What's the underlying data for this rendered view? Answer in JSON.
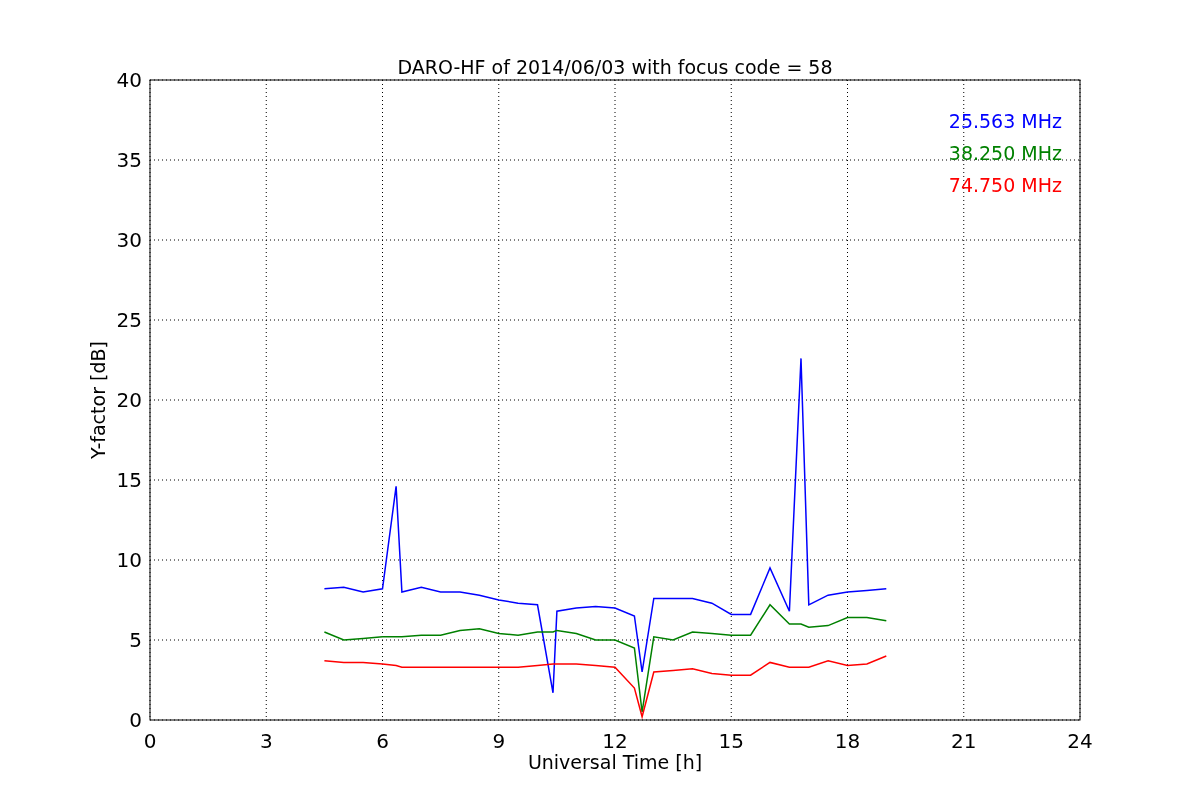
{
  "chart_data": {
    "type": "line",
    "title": "DARO-HF of 2014/06/03 with focus code = 58",
    "xlabel": "Universal Time [h]",
    "ylabel": "Y-factor [dB]",
    "x": [
      4.5,
      5,
      5.5,
      6,
      6.35,
      6.5,
      7,
      7.5,
      8,
      8.5,
      9,
      9.5,
      10,
      10.4,
      10.5,
      11,
      11.5,
      12,
      12.5,
      12.7,
      13,
      13.5,
      14,
      14.5,
      15,
      15.5,
      16,
      16.5,
      16.8,
      17,
      17.5,
      18,
      18.5,
      19
    ],
    "series": [
      {
        "name": "25.563 MHz",
        "color": "#0000ff",
        "values": [
          8.2,
          8.3,
          8.0,
          8.2,
          14.6,
          8.0,
          8.3,
          8.0,
          8.0,
          7.8,
          7.5,
          7.3,
          7.2,
          1.7,
          6.8,
          7.0,
          7.1,
          7.0,
          6.5,
          3.0,
          7.6,
          7.6,
          7.6,
          7.3,
          6.6,
          6.6,
          9.5,
          6.8,
          22.6,
          7.2,
          7.8,
          8.0,
          8.1,
          8.2
        ]
      },
      {
        "name": "38.250 MHz",
        "color": "#008000",
        "values": [
          5.5,
          5.0,
          5.1,
          5.2,
          5.2,
          5.2,
          5.3,
          5.3,
          5.6,
          5.7,
          5.4,
          5.3,
          5.5,
          5.5,
          5.6,
          5.4,
          5.0,
          5.0,
          4.5,
          0.5,
          5.2,
          5.0,
          5.5,
          5.4,
          5.3,
          5.3,
          7.2,
          6.0,
          6.0,
          5.8,
          5.9,
          6.4,
          6.4,
          6.2
        ]
      },
      {
        "name": "74.750 MHz",
        "color": "#ff0000",
        "values": [
          3.7,
          3.6,
          3.6,
          3.5,
          3.4,
          3.3,
          3.3,
          3.3,
          3.3,
          3.3,
          3.3,
          3.3,
          3.4,
          3.5,
          3.5,
          3.5,
          3.4,
          3.3,
          2.0,
          0.2,
          3.0,
          3.1,
          3.2,
          2.9,
          2.8,
          2.8,
          3.6,
          3.3,
          3.3,
          3.3,
          3.7,
          3.4,
          3.5,
          4.0
        ]
      }
    ],
    "xlim": [
      0,
      24
    ],
    "ylim": [
      0,
      40
    ],
    "xticks": [
      0,
      3,
      6,
      9,
      12,
      15,
      18,
      21,
      24
    ],
    "yticks": [
      0,
      5,
      10,
      15,
      20,
      25,
      30,
      35,
      40
    ],
    "grid": true
  }
}
